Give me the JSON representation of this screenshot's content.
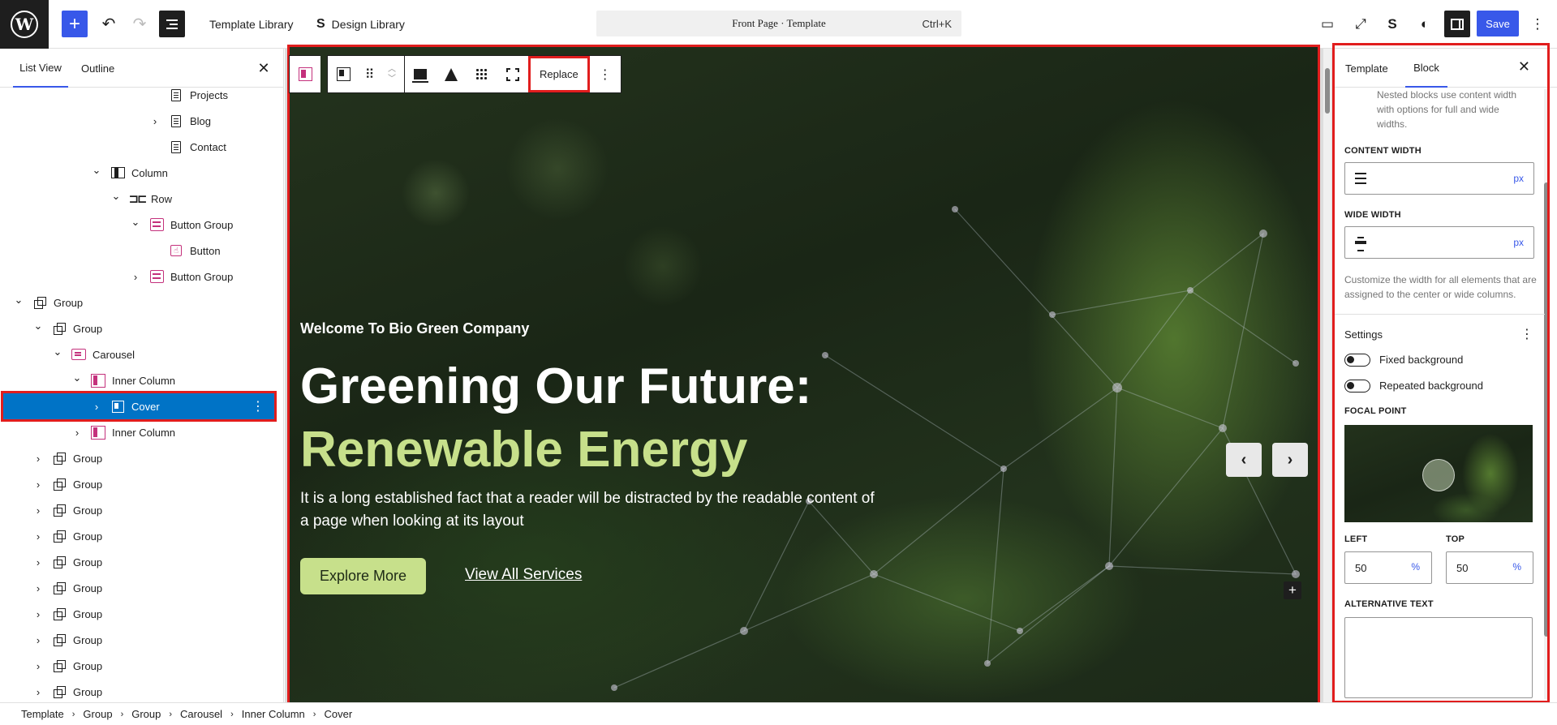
{
  "topbar": {
    "template_library": "Template Library",
    "design_library": "Design Library",
    "command_title": "Front Page · Template",
    "command_shortcut": "Ctrl+K",
    "save_label": "Save"
  },
  "left_panel": {
    "tabs": [
      {
        "label": "List View",
        "active": true
      },
      {
        "label": "Outline",
        "active": false
      }
    ],
    "tree": [
      {
        "label": "Projects",
        "icon": "page-icon",
        "depth": 8,
        "chevron": ""
      },
      {
        "label": "Blog",
        "icon": "page-icon",
        "depth": 8,
        "chevron": "›"
      },
      {
        "label": "Contact",
        "icon": "page-icon",
        "depth": 8,
        "chevron": ""
      },
      {
        "label": "Column",
        "icon": "column-icon",
        "depth": 5,
        "chevron": "⌄"
      },
      {
        "label": "Row",
        "icon": "row-icon",
        "depth": 6,
        "chevron": "⌄"
      },
      {
        "label": "Button Group",
        "icon": "button-group-icon",
        "depth": 7,
        "chevron": "⌄"
      },
      {
        "label": "Button",
        "icon": "button-icon",
        "depth": 8,
        "chevron": ""
      },
      {
        "label": "Button Group",
        "icon": "button-group-icon",
        "depth": 7,
        "chevron": "›"
      },
      {
        "label": "Group",
        "icon": "group-icon",
        "depth": 1,
        "chevron": "⌄"
      },
      {
        "label": "Group",
        "icon": "group-icon",
        "depth": 2,
        "chevron": "⌄"
      },
      {
        "label": "Carousel",
        "icon": "carousel-icon",
        "depth": 3,
        "chevron": "⌄"
      },
      {
        "label": "Inner Column",
        "icon": "inner-column-icon",
        "depth": 4,
        "chevron": "⌄"
      },
      {
        "label": "Cover",
        "icon": "cover-icon",
        "depth": 5,
        "chevron": "›",
        "selected": true
      },
      {
        "label": "Inner Column",
        "icon": "inner-column-icon",
        "depth": 4,
        "chevron": "›"
      },
      {
        "label": "Group",
        "icon": "group-icon",
        "depth": 2,
        "chevron": "›"
      },
      {
        "label": "Group",
        "icon": "group-icon",
        "depth": 2,
        "chevron": "›"
      },
      {
        "label": "Group",
        "icon": "group-icon",
        "depth": 2,
        "chevron": "›"
      },
      {
        "label": "Group",
        "icon": "group-icon",
        "depth": 2,
        "chevron": "›"
      },
      {
        "label": "Group",
        "icon": "group-icon",
        "depth": 2,
        "chevron": "›"
      },
      {
        "label": "Group",
        "icon": "group-icon",
        "depth": 2,
        "chevron": "›"
      },
      {
        "label": "Group",
        "icon": "group-icon",
        "depth": 2,
        "chevron": "›"
      },
      {
        "label": "Group",
        "icon": "group-icon",
        "depth": 2,
        "chevron": "›"
      },
      {
        "label": "Group",
        "icon": "group-icon",
        "depth": 2,
        "chevron": "›"
      },
      {
        "label": "Group",
        "icon": "group-icon",
        "depth": 2,
        "chevron": "›"
      }
    ]
  },
  "block_toolbar": {
    "replace_label": "Replace"
  },
  "hero": {
    "welcome": "Welcome To Bio Green Company",
    "title_line1": "Greening Our Future:",
    "title_line2": "Renewable Energy",
    "description": "It is a long established fact that a reader will be distracted by the readable content of a page when looking at its layout",
    "primary_button": "Explore More",
    "secondary_link": "View All Services",
    "accent_color": "#c7e08b"
  },
  "right_panel": {
    "tabs": [
      {
        "label": "Template",
        "active": false
      },
      {
        "label": "Block",
        "active": true
      }
    ],
    "nested_note": "Nested blocks use content width with options for full and wide widths.",
    "content_width_label": "CONTENT WIDTH",
    "content_width_unit": "px",
    "wide_width_label": "WIDE WIDTH",
    "wide_width_unit": "px",
    "width_help": "Customize the width for all elements that are assigned to the center or wide columns.",
    "settings_heading": "Settings",
    "fixed_background": "Fixed background",
    "repeated_background": "Repeated background",
    "focal_point_label": "FOCAL POINT",
    "left_label": "LEFT",
    "left_value": "50",
    "top_label": "TOP",
    "top_value": "50",
    "percent_unit": "%",
    "alt_text_label": "ALTERNATIVE TEXT"
  },
  "breadcrumbs": [
    "Template",
    "Group",
    "Group",
    "Carousel",
    "Inner Column",
    "Cover"
  ],
  "colors": {
    "wp_blue": "#3858e9",
    "selection_blue": "#0073c6",
    "highlight_red": "#e11d1d"
  }
}
